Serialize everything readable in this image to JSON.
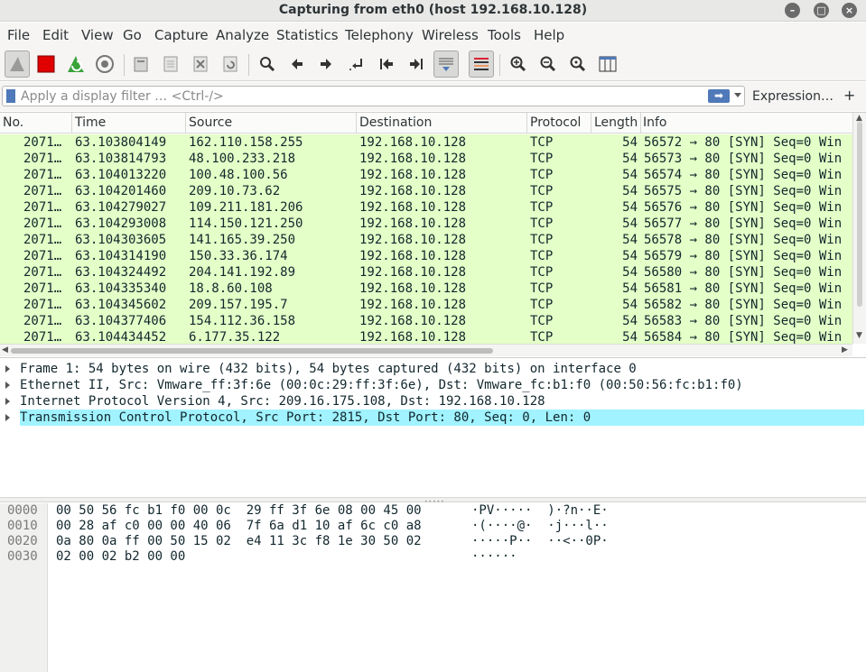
{
  "window": {
    "title": "Capturing from eth0 (host 192.168.10.128)"
  },
  "menu": [
    {
      "label": "File"
    },
    {
      "label": "Edit"
    },
    {
      "label": "View"
    },
    {
      "label": "Go"
    },
    {
      "label": "Capture"
    },
    {
      "label": "Analyze"
    },
    {
      "label": "Statistics"
    },
    {
      "label": "Telephony"
    },
    {
      "label": "Wireless"
    },
    {
      "label": "Tools"
    },
    {
      "label": "Help"
    }
  ],
  "toolbar_icons": [
    "shark-fin-start-icon",
    "stop-capture-icon",
    "restart-capture-icon",
    "capture-options-icon",
    "open-file-icon",
    "save-file-icon",
    "close-file-icon",
    "reload-file-icon",
    "find-packet-icon",
    "go-back-icon",
    "go-forward-icon",
    "go-to-packet-icon",
    "first-packet-icon",
    "last-packet-icon",
    "autoscroll-icon",
    "colorize-icon",
    "zoom-in-icon",
    "zoom-out-icon",
    "normal-size-icon",
    "resize-columns-icon"
  ],
  "filter": {
    "placeholder": "Apply a display filter … <Ctrl-/>",
    "value": "",
    "expression_label": "Expression…",
    "plus_label": "+",
    "apply_arrow": "➡"
  },
  "columns": [
    "No.",
    "Time",
    "Source",
    "Destination",
    "Protocol",
    "Length",
    "Info"
  ],
  "packets": [
    {
      "no": "2071…",
      "time": "63.103804149",
      "source": "162.110.158.255",
      "destination": "192.168.10.128",
      "protocol": "TCP",
      "length": "54",
      "info": "56572 → 80 [SYN] Seq=0 Win"
    },
    {
      "no": "2071…",
      "time": "63.103814793",
      "source": "48.100.233.218",
      "destination": "192.168.10.128",
      "protocol": "TCP",
      "length": "54",
      "info": "56573 → 80 [SYN] Seq=0 Win"
    },
    {
      "no": "2071…",
      "time": "63.104013220",
      "source": "100.48.100.56",
      "destination": "192.168.10.128",
      "protocol": "TCP",
      "length": "54",
      "info": "56574 → 80 [SYN] Seq=0 Win"
    },
    {
      "no": "2071…",
      "time": "63.104201460",
      "source": "209.10.73.62",
      "destination": "192.168.10.128",
      "protocol": "TCP",
      "length": "54",
      "info": "56575 → 80 [SYN] Seq=0 Win"
    },
    {
      "no": "2071…",
      "time": "63.104279027",
      "source": "109.211.181.206",
      "destination": "192.168.10.128",
      "protocol": "TCP",
      "length": "54",
      "info": "56576 → 80 [SYN] Seq=0 Win"
    },
    {
      "no": "2071…",
      "time": "63.104293008",
      "source": "114.150.121.250",
      "destination": "192.168.10.128",
      "protocol": "TCP",
      "length": "54",
      "info": "56577 → 80 [SYN] Seq=0 Win"
    },
    {
      "no": "2071…",
      "time": "63.104303605",
      "source": "141.165.39.250",
      "destination": "192.168.10.128",
      "protocol": "TCP",
      "length": "54",
      "info": "56578 → 80 [SYN] Seq=0 Win"
    },
    {
      "no": "2071…",
      "time": "63.104314190",
      "source": "150.33.36.174",
      "destination": "192.168.10.128",
      "protocol": "TCP",
      "length": "54",
      "info": "56579 → 80 [SYN] Seq=0 Win"
    },
    {
      "no": "2071…",
      "time": "63.104324492",
      "source": "204.141.192.89",
      "destination": "192.168.10.128",
      "protocol": "TCP",
      "length": "54",
      "info": "56580 → 80 [SYN] Seq=0 Win"
    },
    {
      "no": "2071…",
      "time": "63.104335340",
      "source": "18.8.60.108",
      "destination": "192.168.10.128",
      "protocol": "TCP",
      "length": "54",
      "info": "56581 → 80 [SYN] Seq=0 Win"
    },
    {
      "no": "2071…",
      "time": "63.104345602",
      "source": "209.157.195.7",
      "destination": "192.168.10.128",
      "protocol": "TCP",
      "length": "54",
      "info": "56582 → 80 [SYN] Seq=0 Win"
    },
    {
      "no": "2071…",
      "time": "63.104377406",
      "source": "154.112.36.158",
      "destination": "192.168.10.128",
      "protocol": "TCP",
      "length": "54",
      "info": "56583 → 80 [SYN] Seq=0 Win"
    },
    {
      "no": "2071…",
      "time": "63.104434452",
      "source": "6.177.35.122",
      "destination": "192.168.10.128",
      "protocol": "TCP",
      "length": "54",
      "info": "56584 → 80 [SYN] Seq=0 Win"
    }
  ],
  "details": [
    {
      "text": "Frame 1: 54 bytes on wire (432 bits), 54 bytes captured (432 bits) on interface 0",
      "selected": false
    },
    {
      "text": "Ethernet II, Src: Vmware_ff:3f:6e (00:0c:29:ff:3f:6e), Dst: Vmware_fc:b1:f0 (00:50:56:fc:b1:f0)",
      "selected": false
    },
    {
      "text": "Internet Protocol Version 4, Src: 209.16.175.108, Dst: 192.168.10.128",
      "selected": false
    },
    {
      "text": "Transmission Control Protocol, Src Port: 2815, Dst Port: 80, Seq: 0, Len: 0",
      "selected": true
    }
  ],
  "bytes": [
    {
      "offset": "0000",
      "hex": "00 50 56 fc b1 f0 00 0c  29 ff 3f 6e 08 00 45 00",
      "ascii": "·PV·····  )·?n··E·"
    },
    {
      "offset": "0010",
      "hex": "00 28 af c0 00 00 40 06  7f 6a d1 10 af 6c c0 a8",
      "ascii": "·(····@·  ·j···l··"
    },
    {
      "offset": "0020",
      "hex": "0a 80 0a ff 00 50 15 02  e4 11 3c f8 1e 30 50 02",
      "ascii": "·····P··  ··<··0P·"
    },
    {
      "offset": "0030",
      "hex": "02 00 02 b2 00 00",
      "ascii": "······"
    }
  ],
  "colors": {
    "row_tcp": "#e4ffc7",
    "selected_detail": "#a0f3ff",
    "stop_red": "#e00000",
    "accent_blue": "#4f79b8"
  }
}
